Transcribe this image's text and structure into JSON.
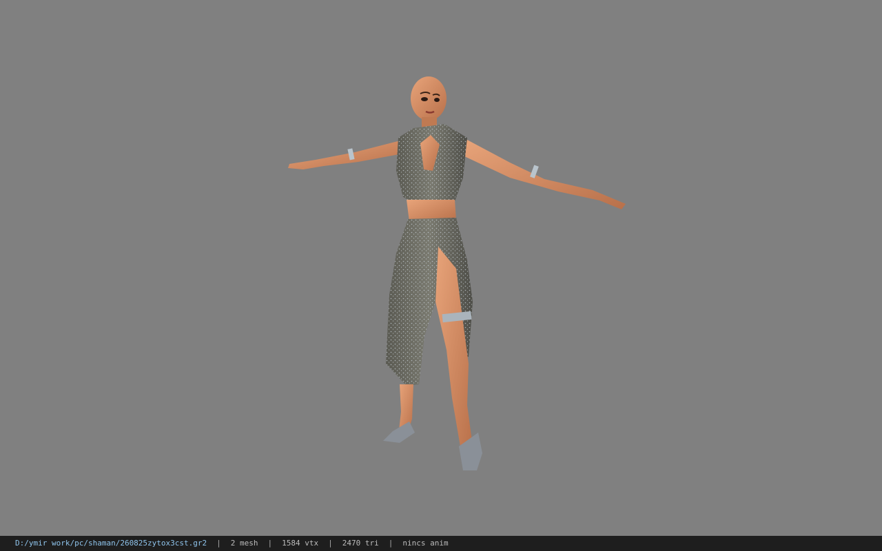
{
  "viewport": {
    "background": "#808080",
    "object": "character-model-shaman"
  },
  "status": {
    "path": "D:/ymir work/pc/shaman/260825zytox3cst.gr2",
    "mesh": "2 mesh",
    "vtx": "1584 vtx",
    "tri": "2470 tri",
    "anim": "nincs anim",
    "separator": "|"
  },
  "colors": {
    "statusbar_bg": "#1e1e1e",
    "path_text": "#8fc4ec",
    "info_text": "#bcbcbc"
  }
}
